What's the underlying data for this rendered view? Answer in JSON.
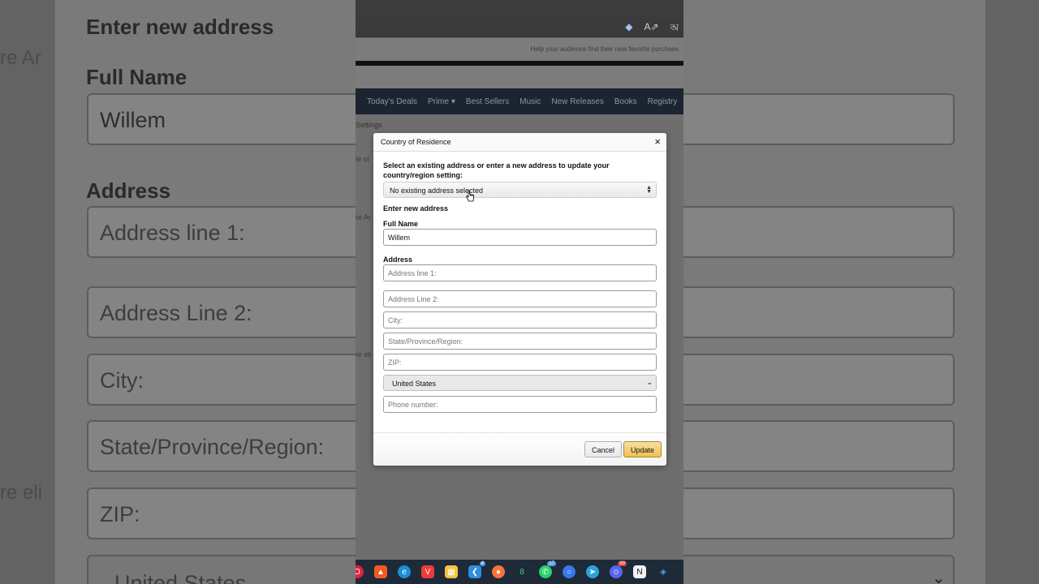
{
  "background": {
    "left_heading": "Enter new address",
    "left_fullname_label": "Full Name",
    "left_fullname_value": "Willem",
    "left_address_label": "Address",
    "left_fields": [
      "Address line 1:",
      "Address Line 2:",
      "City:",
      "State/Province/Region:",
      "ZIP:",
      "United States"
    ],
    "left_ghost_1": "re Ar",
    "left_ghost_2": "re eli"
  },
  "browser": {
    "tagline": "Help your audience find their new favorite purchase.",
    "nav_items": [
      "Today's Deals",
      "Prime ▾",
      "Best Sellers",
      "Music",
      "New Releases",
      "Books",
      "Registry"
    ],
    "breadcrumb": "Settings",
    "side_frags": [
      "le or",
      "re Ar",
      "re eli"
    ]
  },
  "modal": {
    "title": "Country of Residence",
    "close_label": "×",
    "intro": "Select an existing address or enter a new address to update your country/region setting:",
    "existing_select": "No existing address selected",
    "enter_new_label": "Enter new address",
    "fullname_label": "Full Name",
    "fullname_value": "Willem",
    "address_label": "Address",
    "placeholders": {
      "address1": "Address line 1:",
      "address2": "Address Line 2:",
      "city": "City:",
      "state": "State/Province/Region:",
      "zip": "ZIP:",
      "phone": "Phone number:"
    },
    "country": "United States",
    "cancel_label": "Cancel",
    "update_label": "Update"
  },
  "colors": {
    "nav_bg": "#1b2430",
    "update_btn": "#f0c14b",
    "taskbar_bg": "#1e2a38"
  },
  "taskbar": {
    "icons": [
      "opera-icon",
      "brave-icon",
      "edge-icon",
      "vivaldi-icon",
      "files-icon",
      "vscode-icon",
      "firefox-icon",
      "app-icon",
      "whatsapp-icon",
      "signal-icon",
      "telegram-icon",
      "discord-icon",
      "notion-icon",
      "layers-icon"
    ],
    "badges": {
      "vscode": "4",
      "whatsapp": "17",
      "discord": "99"
    }
  }
}
